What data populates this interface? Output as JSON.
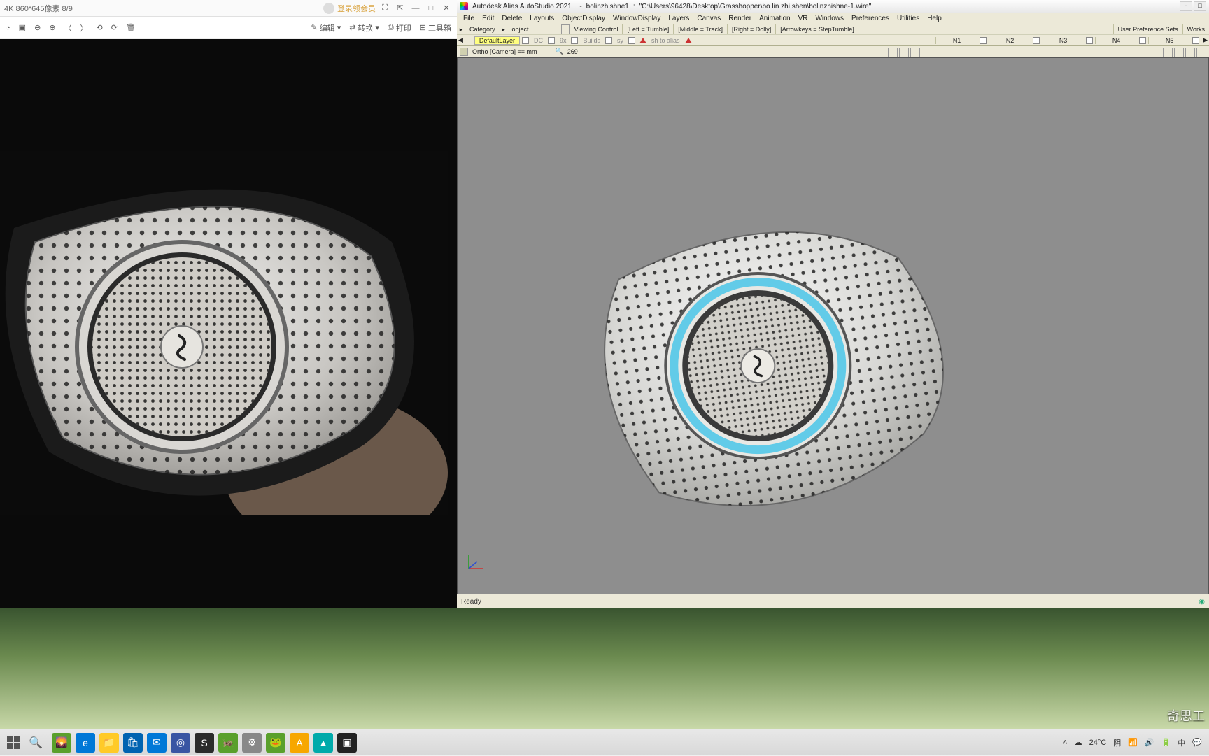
{
  "viewer": {
    "title_left": "4K  860*645像素   8/9",
    "login": "登录领会员",
    "toolbar": {
      "edit": "编辑",
      "convert": "转换",
      "print": "打印",
      "toolbox": "工具箱"
    }
  },
  "alias": {
    "app": "Autodesk Alias AutoStudio 2021",
    "doc": "bolinzhishne1",
    "path": "\"C:\\Users\\96428\\Desktop\\Grasshopper\\bo lin zhi shen\\bolinzhishne-1.wire\"",
    "menu": [
      "File",
      "Edit",
      "Delete",
      "Layouts",
      "ObjectDisplay",
      "WindowDisplay",
      "Layers",
      "Canvas",
      "Render",
      "Animation",
      "VR",
      "Windows",
      "Preferences",
      "Utilities",
      "Help"
    ],
    "row2": {
      "category": "Category",
      "object": "object",
      "viewing": "Viewing Control",
      "left": "[Left = Tumble]",
      "middle": "[Middle = Track]",
      "right": "[Right = Dolly]",
      "arrows": "[Arrowkeys = StepTumble]",
      "prefs": "User Preference Sets",
      "work": "Works"
    },
    "row3": {
      "layer": "DefaultLayer",
      "labels": [
        "DC",
        "9x",
        "Builds",
        "sy",
        "sh to alias"
      ],
      "n": [
        "N1",
        "N2",
        "N3",
        "N4",
        "N5"
      ]
    },
    "row4": {
      "view": "Ortho [Camera] == mm",
      "zoom": "269"
    },
    "status": "Ready"
  },
  "taskbar": {
    "weather_temp": "24°C",
    "weather_label": "阴",
    "ime": "中",
    "apps": [
      {
        "c": "#5aa02c",
        "t": "🌄"
      },
      {
        "c": "#0078d7",
        "t": "e"
      },
      {
        "c": "#ffca28",
        "t": "📁"
      },
      {
        "c": "#0063b1",
        "t": "🛍"
      },
      {
        "c": "#0078d7",
        "t": "✉"
      },
      {
        "c": "#3955a3",
        "t": "◎"
      },
      {
        "c": "#2b2b2b",
        "t": "S"
      },
      {
        "c": "#5aa02c",
        "t": "🦗"
      },
      {
        "c": "#888",
        "t": "⚙"
      },
      {
        "c": "#5aa02c",
        "t": "🐸"
      },
      {
        "c": "#f7a700",
        "t": "A"
      },
      {
        "c": "#0aa",
        "t": "▲"
      },
      {
        "c": "#222",
        "t": "▣"
      }
    ]
  },
  "watermark": "奇思工"
}
